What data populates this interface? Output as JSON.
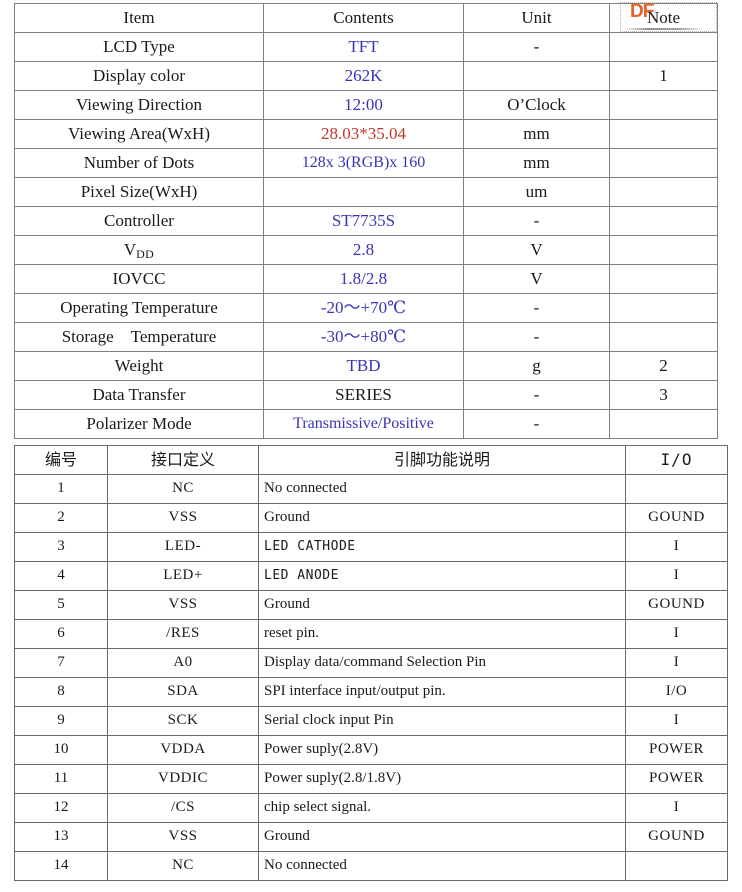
{
  "document": {
    "type": "lcd-module-datasheet-page",
    "watermark": {
      "text": "DF",
      "color": "#e8622a"
    }
  },
  "spec_table": {
    "name": "general-specifications",
    "columns": [
      "Item",
      "Contents",
      "Unit",
      "Note"
    ],
    "rows": [
      {
        "item": "LCD Type",
        "contents": "TFT",
        "contents_color": "#3a33b8",
        "unit": "-",
        "note": ""
      },
      {
        "item": "Display color",
        "contents": "262K",
        "contents_color": "#3a33b8",
        "unit": "",
        "note": "1"
      },
      {
        "item": "Viewing Direction",
        "contents": "12:00",
        "contents_color": "#3a33b8",
        "unit": "O’Clock",
        "note": ""
      },
      {
        "item": "Viewing Area(WxH)",
        "contents": "28.03*35.04",
        "contents_color": "#c0392b",
        "unit": "mm",
        "note": ""
      },
      {
        "item": "Number of Dots",
        "contents": "128x 3(RGB)x 160",
        "contents_color": "#3a33b8",
        "unit": "mm",
        "note": ""
      },
      {
        "item": "Pixel Size(WxH)",
        "contents": "",
        "contents_color": "#3a33b8",
        "unit": "um",
        "note": ""
      },
      {
        "item": "Controller",
        "contents": "ST7735S",
        "contents_color": "#3a33b8",
        "unit": "-",
        "note": ""
      },
      {
        "item": "VDD",
        "contents": "2.8",
        "contents_color": "#3a33b8",
        "unit": "V",
        "note": "",
        "item_base": "V",
        "item_sub": "DD"
      },
      {
        "item": "IOVCC",
        "contents": "1.8/2.8",
        "contents_color": "#3a33b8",
        "unit": "V",
        "note": ""
      },
      {
        "item": "Operating Temperature",
        "contents": "-20～+70℃",
        "contents_color": "#3a33b8",
        "unit": "-",
        "note": ""
      },
      {
        "item": "Storage　Temperature",
        "contents": "-30～+80℃",
        "contents_color": "#3a33b8",
        "unit": "-",
        "note": ""
      },
      {
        "item": "Weight",
        "contents": "TBD",
        "contents_color": "#3a33b8",
        "unit": "g",
        "note": "2"
      },
      {
        "item": "Data Transfer",
        "contents": "SERIES",
        "contents_color": "#1a1a1a",
        "unit": "-",
        "note": "3"
      },
      {
        "item": "Polarizer Mode",
        "contents": "Transmissive/Positive",
        "contents_color": "#3a33b8",
        "unit": "-",
        "note": ""
      }
    ]
  },
  "pin_table": {
    "name": "pin-definition",
    "columns": [
      "编号",
      "接口定义",
      "引脚功能说明",
      "I/O"
    ],
    "rows": [
      {
        "no": "1",
        "def": "NC",
        "desc": "No connected",
        "io": ""
      },
      {
        "no": "2",
        "def": "VSS",
        "desc": "Ground",
        "io": "GOUND"
      },
      {
        "no": "3",
        "def": "LED-",
        "desc": "LED CATHODE",
        "io": "I",
        "desc_mono": true
      },
      {
        "no": "4",
        "def": "LED+",
        "desc": "LED ANODE",
        "io": "I",
        "desc_mono": true
      },
      {
        "no": "5",
        "def": "VSS",
        "desc": "Ground",
        "io": "GOUND"
      },
      {
        "no": "6",
        "def": "/RES",
        "desc": "reset pin.",
        "io": "I"
      },
      {
        "no": "7",
        "def": "A0",
        "desc": "Display data/command Selection Pin",
        "io": "I"
      },
      {
        "no": "8",
        "def": "SDA",
        "desc": "SPI interface input/output pin.",
        "io": "I/O"
      },
      {
        "no": "9",
        "def": "SCK",
        "desc": "Serial clock input Pin",
        "io": "I"
      },
      {
        "no": "10",
        "def": "VDDA",
        "desc": "Power suply(2.8V)",
        "io": "POWER"
      },
      {
        "no": "11",
        "def": "VDDIC",
        "desc": "Power suply(2.8/1.8V)",
        "io": "POWER"
      },
      {
        "no": "12",
        "def": "/CS",
        "desc": "chip select signal.",
        "io": "I"
      },
      {
        "no": "13",
        "def": "VSS",
        "desc": "Ground",
        "io": "GOUND"
      },
      {
        "no": "14",
        "def": "NC",
        "desc": "No connected",
        "io": ""
      }
    ]
  }
}
